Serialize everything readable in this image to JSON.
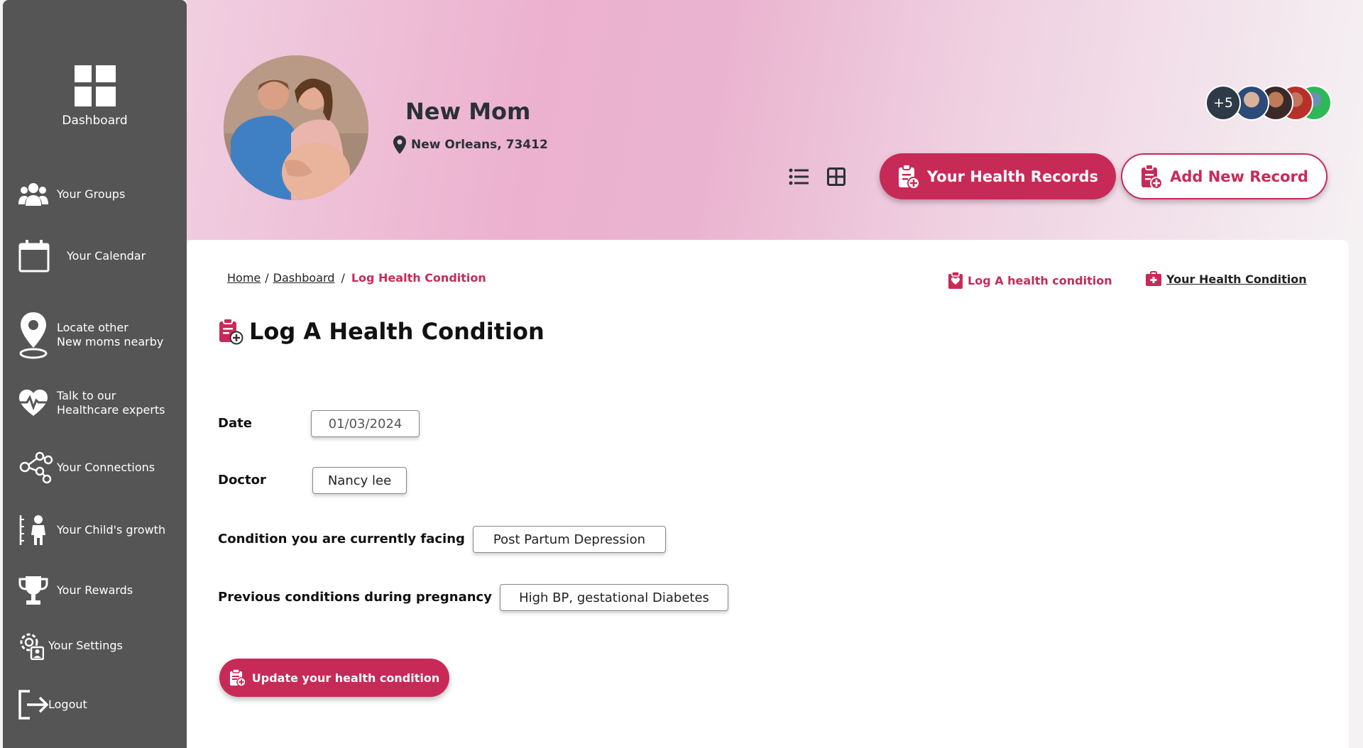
{
  "sidebar": {
    "dashboard_label": "Dashboard",
    "items": [
      {
        "label": "Your Groups",
        "icon": "users-icon"
      },
      {
        "label": "Your Calendar",
        "icon": "calendar-icon"
      },
      {
        "label": "Locate other\nNew moms nearby",
        "icon": "map-pin-icon"
      },
      {
        "label": "Talk to our\nHealthcare experts",
        "icon": "heart-pulse-icon"
      },
      {
        "label": "Your Connections",
        "icon": "connections-icon"
      },
      {
        "label": "Your Child's growth",
        "icon": "child-growth-icon"
      },
      {
        "label": "Your Rewards",
        "icon": "trophy-icon"
      },
      {
        "label": "Your  Settings",
        "icon": "settings-user-icon"
      },
      {
        "label": "Logout",
        "icon": "logout-icon"
      }
    ]
  },
  "header": {
    "profile_name": "New Mom",
    "location": "New Orleans, 73412",
    "records_button": "Your Health Records",
    "add_button": "Add New Record",
    "group_more": "+5"
  },
  "breadcrumb": {
    "home": "Home",
    "sep1": "/",
    "dashboard": "Dashboard",
    "sep2": "/",
    "current": "Log Health Condition"
  },
  "top_links": {
    "log": "Log A health condition",
    "view": "Your Health Condition"
  },
  "page_title": "Log A Health Condition",
  "form": {
    "date_label": "Date",
    "date_value": "01/03/2024",
    "doctor_label": "Doctor",
    "doctor_value": "Nancy lee",
    "current_label": "Condition you are currently facing",
    "current_value": "Post Partum Depression",
    "previous_label": "Previous conditions during pregnancy",
    "previous_value": "High BP, gestational Diabetes",
    "submit_label": "Update your health condition"
  },
  "colors": {
    "accent": "#c82a57",
    "sidebar": "#555555",
    "text_dark": "#2b3038"
  }
}
